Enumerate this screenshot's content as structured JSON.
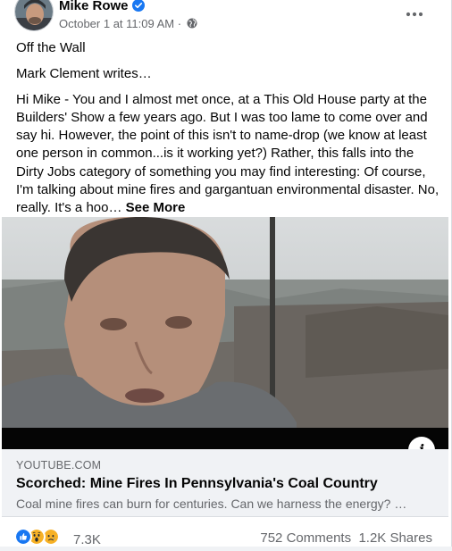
{
  "post": {
    "author": "Mike Rowe",
    "timestamp": "October 1 at 11:09 AM",
    "separator": "·",
    "privacy_icon": "globe-icon",
    "verified_icon": "verified-badge-icon",
    "more_icon": "more-options-icon",
    "paragraphs": [
      "Off the Wall",
      "Mark Clement writes…",
      "Hi Mike - You and I almost met once, at a This Old House party at the Builders' Show a few years ago. But I was too lame to come over and say hi. However, the point of this isn't to name-drop (we know at least one person in common...is it working yet?) Rather, this falls into the Dirty Jobs category of something you may find interesting: Of course, I'm talking about mine fires and gargantuan environmental disaster. No, really. It's a hoo…"
    ],
    "see_more": "See More"
  },
  "link_preview": {
    "domain": "YOUTUBE.COM",
    "title": "Scorched: Mine Fires In Pennsylvania's Coal Country",
    "description": "Coal mine fires can burn for centuries. Can we harness the energy? …",
    "info_label": "i"
  },
  "footer": {
    "reaction_icons": [
      "like-icon",
      "wow-icon",
      "sad-icon"
    ],
    "reaction_count": "7.3K",
    "comments": "752 Comments",
    "shares": "1.2K Shares"
  },
  "colors": {
    "brand_blue": "#1877f2",
    "secondary_text": "#65676b",
    "preview_bg": "#f0f2f5"
  }
}
